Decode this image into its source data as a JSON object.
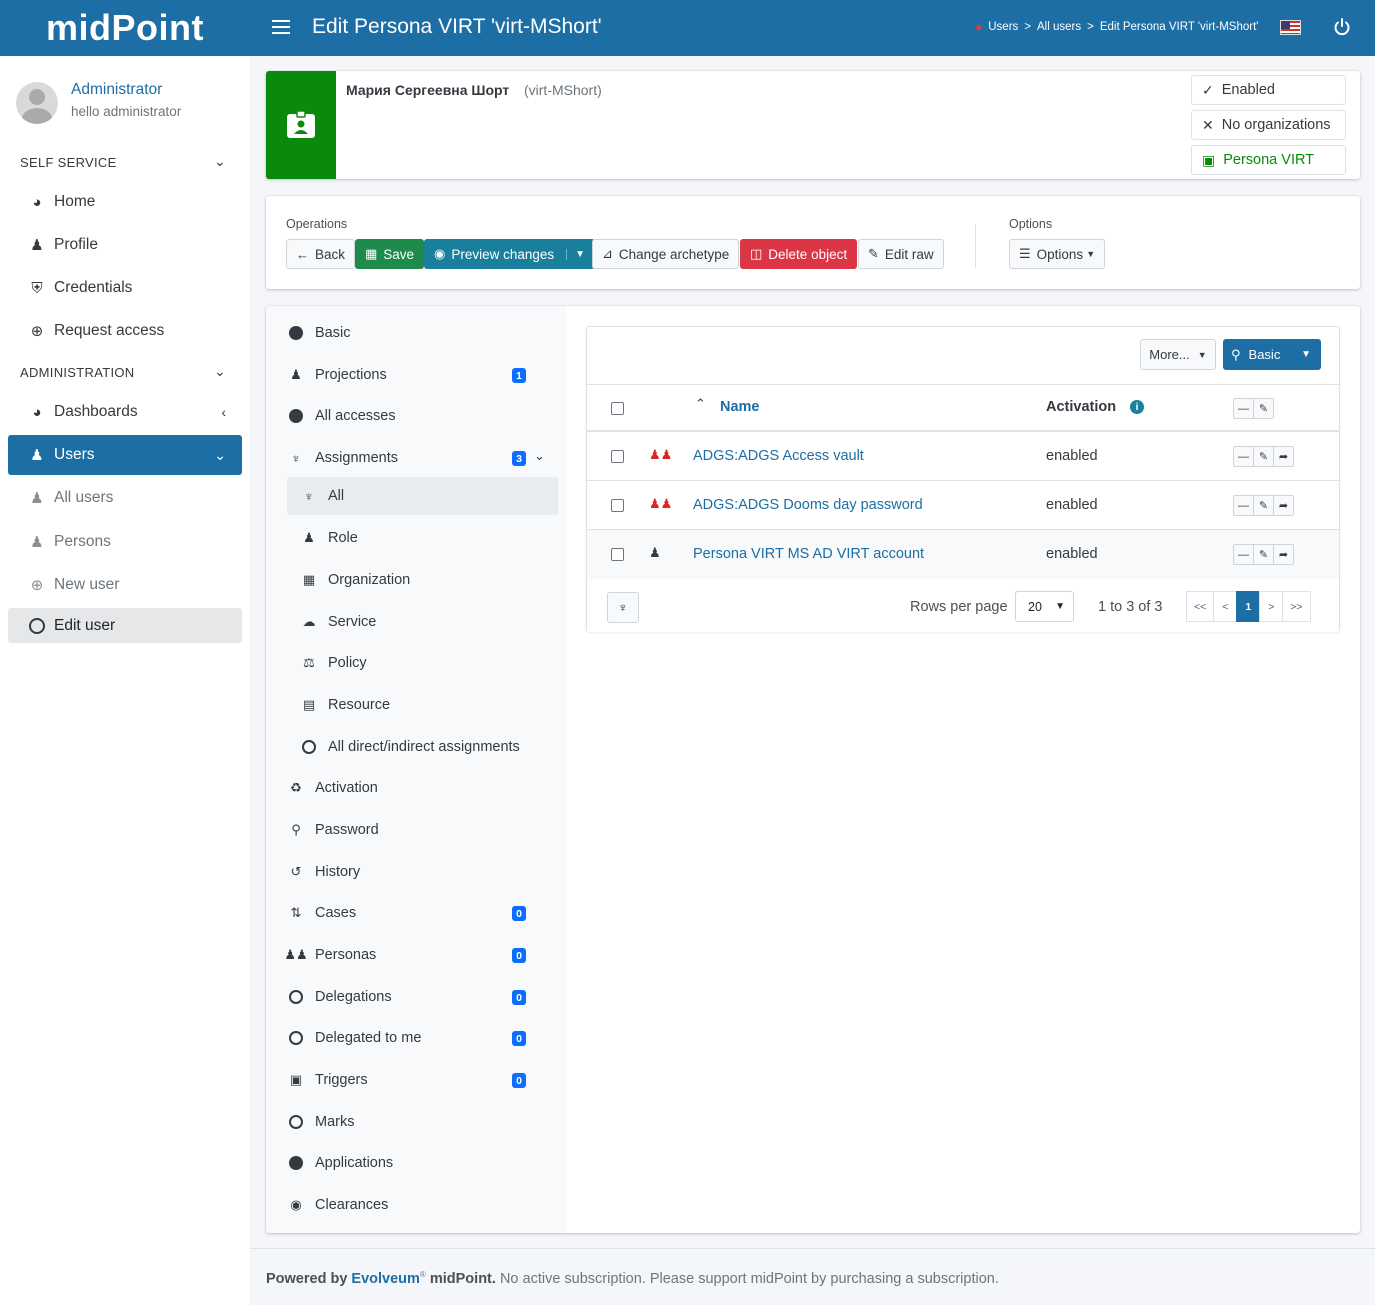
{
  "header": {
    "brand": "midPoint",
    "title": "Edit Persona VIRT 'virt-MShort'",
    "breadcrumb": [
      "Users",
      "All users",
      "Edit Persona VIRT 'virt-MShort'"
    ],
    "breadcrumb_sep": ">"
  },
  "sidebar": {
    "user_name": "Administrator",
    "user_sub": "hello administrator",
    "self_service_label": "SELF SERVICE",
    "self_service": [
      {
        "label": "Home",
        "icon": "dashboard-icon"
      },
      {
        "label": "Profile",
        "icon": "user-icon"
      },
      {
        "label": "Credentials",
        "icon": "shield-icon"
      },
      {
        "label": "Request access",
        "icon": "plus-circle-icon"
      }
    ],
    "administration_label": "ADMINISTRATION",
    "dashboards": "Dashboards",
    "users": "Users",
    "users_sub": [
      "All users",
      "Persons",
      "New user",
      "Edit user"
    ]
  },
  "object": {
    "name": "Мария Сергеевна Шорт",
    "oid": "(virt-MShort)",
    "tags": [
      "Enabled",
      "No organizations",
      "Persona VIRT"
    ],
    "icon_color": "#0a8a0a"
  },
  "operations": {
    "label": "Operations",
    "buttons": [
      "Back",
      "Save",
      "Preview changes",
      "Change archetype",
      "Delete object",
      "Edit raw"
    ],
    "options_label": "Options",
    "options_button": "Options"
  },
  "menu": {
    "items": [
      {
        "label": "Basic"
      },
      {
        "label": "Projections",
        "badge": "1"
      },
      {
        "label": "All accesses"
      },
      {
        "label": "Assignments",
        "badge": "3"
      },
      {
        "label": "All"
      },
      {
        "label": "Role"
      },
      {
        "label": "Organization"
      },
      {
        "label": "Service"
      },
      {
        "label": "Policy"
      },
      {
        "label": "Resource"
      },
      {
        "label": "All direct/indirect assignments"
      },
      {
        "label": "Activation"
      },
      {
        "label": "Password"
      },
      {
        "label": "History"
      },
      {
        "label": "Cases",
        "badge": "0"
      },
      {
        "label": "Personas",
        "badge": "0"
      },
      {
        "label": "Delegations",
        "badge": "0"
      },
      {
        "label": "Delegated to me",
        "badge": "0"
      },
      {
        "label": "Triggers",
        "badge": "0"
      },
      {
        "label": "Marks"
      },
      {
        "label": "Applications"
      },
      {
        "label": "Clearances"
      }
    ]
  },
  "table": {
    "more_button": "More...",
    "search_button": "Basic",
    "columns": {
      "name": "Name",
      "activation": "Activation"
    },
    "rows": [
      {
        "name": "ADGS:ADGS Access vault",
        "activation": "enabled",
        "icon": "role-group-icon"
      },
      {
        "name": "ADGS:ADGS Dooms day password",
        "activation": "enabled",
        "icon": "role-group-icon"
      },
      {
        "name": "Persona VIRT MS AD VIRT account",
        "activation": "enabled",
        "icon": "persona-icon"
      }
    ],
    "rows_per_page_label": "Rows per page",
    "rows_per_page": "20",
    "range": "1 to 3 of 3",
    "pager": [
      "<<",
      "<",
      "1",
      ">",
      ">>"
    ]
  },
  "footer": {
    "powered_by": "Powered by",
    "company": "Evolveum",
    "product": "midPoint.",
    "message": "No active subscription. Please support midPoint by purchasing a subscription."
  },
  "colors": {
    "primary": "#1c6ea4",
    "success": "#1e8a4c",
    "info": "#1a7f9c",
    "danger": "#dc3545",
    "persona_green": "#0a8a0a"
  }
}
